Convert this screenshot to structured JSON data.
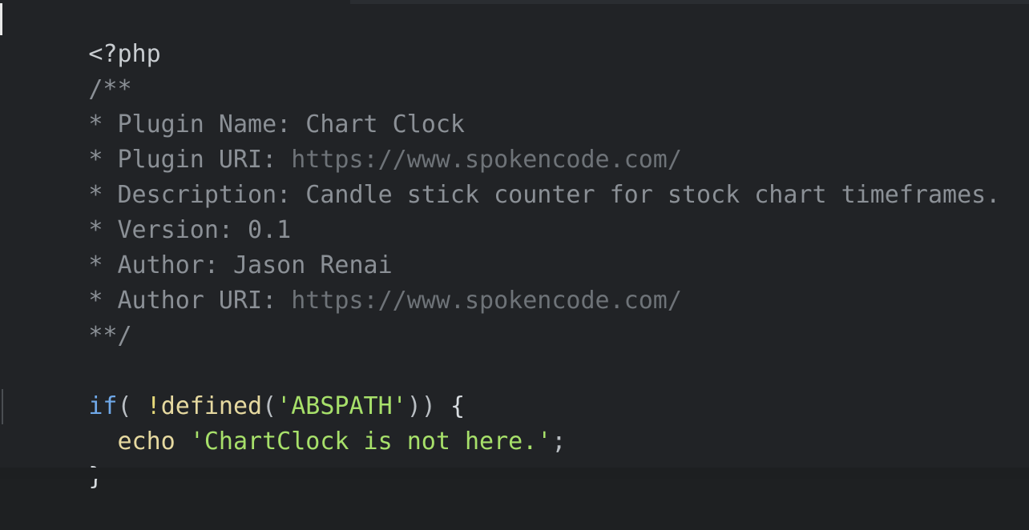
{
  "editor": {
    "language": "php",
    "background_color": "#212326",
    "theme": "dark"
  },
  "colors": {
    "default": "#c8ccd0",
    "comment": "#8b9096",
    "comment_url": "#6e7378",
    "keyword": "#6fa8e8",
    "function": "#e6d9a0",
    "operator": "#e6d97a",
    "string": "#a7e06a",
    "punctuation": "#b9bec3",
    "caret": "#e8e8e8"
  },
  "code": {
    "line1": {
      "open_tag": "<?php"
    },
    "line2": {
      "comment_open": "/**"
    },
    "line3": {
      "text": "* Plugin Name: Chart Clock"
    },
    "line4": {
      "label": "* Plugin URI: ",
      "url": "https://www.spokencode.com/"
    },
    "line5": {
      "text": "* Description: Candle stick counter for stock chart timeframes."
    },
    "line6": {
      "text": "* Version: 0.1"
    },
    "line7": {
      "text": "* Author: Jason Renai"
    },
    "line8": {
      "label": "* Author URI: ",
      "url": "https://www.spokencode.com/"
    },
    "line9": {
      "comment_close": "**/"
    },
    "line10": {
      "text": ""
    },
    "line11": {
      "keyword": "if",
      "paren_open": "( ",
      "not_operator": "!",
      "function": "defined",
      "inner_paren_open": "(",
      "string": "'ABSPATH'",
      "parens_close": "))",
      "space": " ",
      "brace_open": "{"
    },
    "line12": {
      "indent": "  ",
      "keyword": "echo",
      "space": " ",
      "string": "'ChartClock is not here.'",
      "semicolon": ";"
    },
    "line13": {
      "brace_close": "}"
    }
  }
}
